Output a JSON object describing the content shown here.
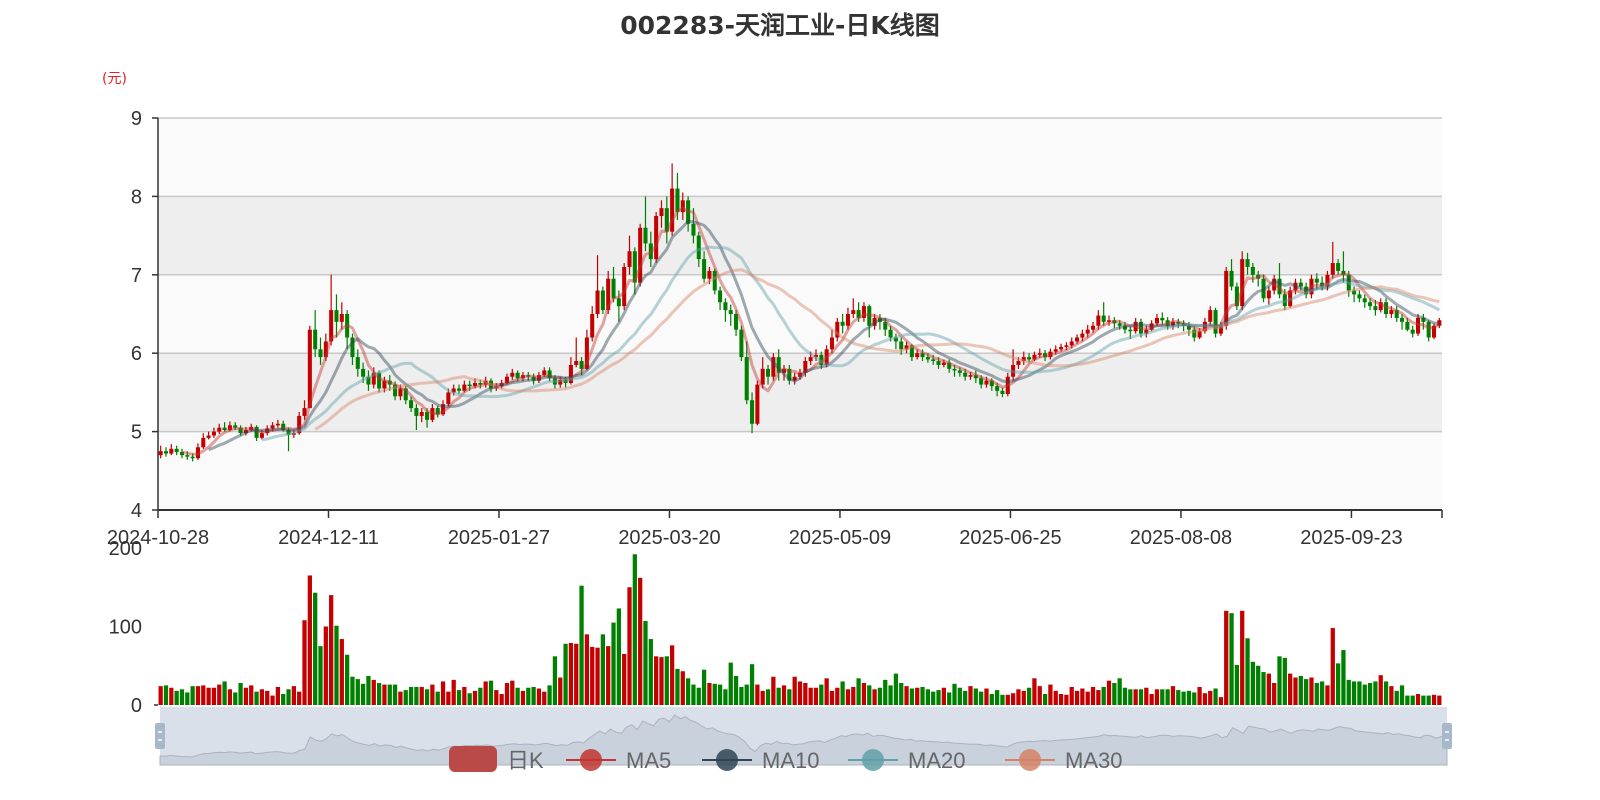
{
  "chart_data": {
    "type": "candlestick",
    "title": "002283-天润工业-日K线图",
    "ylabel": "(元)",
    "price_axis": {
      "ylim": [
        4,
        9
      ],
      "ticks": [
        4,
        5,
        6,
        7,
        8,
        9
      ]
    },
    "volume_axis": {
      "ylim": [
        0,
        200
      ],
      "ticks": [
        0,
        100,
        200
      ]
    },
    "x_tick_labels": [
      "2024-10-28",
      "2024-12-11",
      "2025-01-27",
      "2025-03-20",
      "2025-05-09",
      "2025-06-25",
      "2025-08-08",
      "2025-09-23"
    ],
    "grid": true,
    "legend": {
      "position": "bottom",
      "items": [
        "日K",
        "MA5",
        "MA10",
        "MA20",
        "MA30"
      ]
    },
    "colors": {
      "up": "#c40000",
      "down": "#008000",
      "MA5": "#c23531",
      "MA10": "#2f4554",
      "MA20": "#61a0a8",
      "MA30": "#d48265",
      "legend_k": "#b94a48"
    },
    "open": [
      4.7,
      4.75,
      4.72,
      4.78,
      4.74,
      4.7,
      4.68,
      4.66,
      4.8,
      4.92,
      4.95,
      5.0,
      5.05,
      5.02,
      5.08,
      5.05,
      4.98,
      5.02,
      5.06,
      4.92,
      4.98,
      5.04,
      5.08,
      5.1,
      5.02,
      4.96,
      4.98,
      5.2,
      5.3,
      6.3,
      6.05,
      5.95,
      6.15,
      6.55,
      6.4,
      6.5,
      6.2,
      5.95,
      5.8,
      5.7,
      5.6,
      5.75,
      5.55,
      5.65,
      5.6,
      5.45,
      5.55,
      5.4,
      5.3,
      5.2,
      5.25,
      5.15,
      5.3,
      5.22,
      5.35,
      5.5,
      5.55,
      5.52,
      5.6,
      5.58,
      5.62,
      5.6,
      5.65,
      5.55,
      5.58,
      5.62,
      5.7,
      5.75,
      5.68,
      5.72,
      5.7,
      5.65,
      5.72,
      5.78,
      5.68,
      5.6,
      5.66,
      5.62,
      5.85,
      5.9,
      5.8,
      6.2,
      6.5,
      6.8,
      6.55,
      6.95,
      6.7,
      6.6,
      7.1,
      7.3,
      6.9,
      7.6,
      7.4,
      7.2,
      7.75,
      7.85,
      7.55,
      8.1,
      7.8,
      7.95,
      7.65,
      7.5,
      7.2,
      6.95,
      7.05,
      6.8,
      6.65,
      6.55,
      6.5,
      6.3,
      5.95,
      5.4,
      5.1,
      5.6,
      5.8,
      5.7,
      5.95,
      5.75,
      5.8,
      5.65,
      5.7,
      5.75,
      5.9,
      5.95,
      5.98,
      5.85,
      6.05,
      6.2,
      6.4,
      6.35,
      6.5,
      6.55,
      6.45,
      6.6,
      6.35,
      6.45,
      6.4,
      6.3,
      6.2,
      6.15,
      6.05,
      6.1,
      5.95,
      6.0,
      5.95,
      5.92,
      5.9,
      5.85,
      5.88,
      5.8,
      5.78,
      5.75,
      5.7,
      5.72,
      5.68,
      5.6,
      5.65,
      5.58,
      5.52,
      5.48,
      5.7,
      5.85,
      5.9,
      5.95,
      5.92,
      5.98,
      6.0,
      5.95,
      6.02,
      6.05,
      6.08,
      6.1,
      6.15,
      6.2,
      6.25,
      6.3,
      6.35,
      6.48,
      6.4,
      6.42,
      6.38,
      6.35,
      6.3,
      6.28,
      6.4,
      6.25,
      6.3,
      6.38,
      6.45,
      6.42,
      6.35,
      6.4,
      6.38,
      6.35,
      6.3,
      6.2,
      6.28,
      6.4,
      6.55,
      6.25,
      6.35,
      7.05,
      6.85,
      6.6,
      7.2,
      7.1,
      7.0,
      6.95,
      6.7,
      6.8,
      6.95,
      6.75,
      6.6,
      6.8,
      6.9,
      6.85,
      6.75,
      6.95,
      6.9,
      6.85,
      7.0,
      7.15,
      7.05,
      7.0,
      6.8,
      6.75,
      6.7,
      6.65,
      6.6,
      6.55,
      6.65,
      6.5,
      6.55,
      6.45,
      6.4,
      6.3,
      6.25,
      6.45,
      6.4,
      6.2,
      6.35
    ],
    "close": [
      4.75,
      4.72,
      4.78,
      4.74,
      4.7,
      4.68,
      4.66,
      4.8,
      4.92,
      4.95,
      5.0,
      5.05,
      5.02,
      5.08,
      5.05,
      4.98,
      5.02,
      5.06,
      4.92,
      4.98,
      5.04,
      5.08,
      5.1,
      5.02,
      4.96,
      4.98,
      5.2,
      5.3,
      6.3,
      6.05,
      5.95,
      6.15,
      6.55,
      6.4,
      6.5,
      6.2,
      5.95,
      5.8,
      5.7,
      5.6,
      5.75,
      5.55,
      5.65,
      5.6,
      5.45,
      5.55,
      5.4,
      5.3,
      5.2,
      5.25,
      5.15,
      5.3,
      5.22,
      5.35,
      5.5,
      5.55,
      5.52,
      5.6,
      5.58,
      5.62,
      5.6,
      5.65,
      5.55,
      5.58,
      5.62,
      5.7,
      5.75,
      5.68,
      5.72,
      5.7,
      5.65,
      5.72,
      5.78,
      5.68,
      5.6,
      5.66,
      5.62,
      5.85,
      5.9,
      5.8,
      6.2,
      6.5,
      6.8,
      6.55,
      6.95,
      6.7,
      6.6,
      7.1,
      7.3,
      6.9,
      7.6,
      7.4,
      7.2,
      7.75,
      7.85,
      7.55,
      8.1,
      7.8,
      7.95,
      7.65,
      7.5,
      7.2,
      6.95,
      7.05,
      6.8,
      6.65,
      6.55,
      6.5,
      6.3,
      5.95,
      5.4,
      5.1,
      5.6,
      5.8,
      5.7,
      5.95,
      5.75,
      5.8,
      5.65,
      5.7,
      5.75,
      5.9,
      5.95,
      5.98,
      5.85,
      6.05,
      6.2,
      6.4,
      6.35,
      6.5,
      6.55,
      6.45,
      6.6,
      6.35,
      6.45,
      6.4,
      6.3,
      6.2,
      6.15,
      6.05,
      6.1,
      5.95,
      6.0,
      5.95,
      5.92,
      5.9,
      5.85,
      5.88,
      5.8,
      5.78,
      5.75,
      5.7,
      5.72,
      5.68,
      5.6,
      5.65,
      5.58,
      5.52,
      5.48,
      5.7,
      5.85,
      5.9,
      5.95,
      5.92,
      5.98,
      6.0,
      5.95,
      6.02,
      6.05,
      6.08,
      6.1,
      6.15,
      6.2,
      6.25,
      6.3,
      6.35,
      6.48,
      6.4,
      6.42,
      6.38,
      6.35,
      6.3,
      6.28,
      6.4,
      6.25,
      6.3,
      6.38,
      6.45,
      6.42,
      6.35,
      6.4,
      6.38,
      6.35,
      6.3,
      6.2,
      6.28,
      6.4,
      6.55,
      6.25,
      6.35,
      7.05,
      6.85,
      6.6,
      7.2,
      7.1,
      7.0,
      6.95,
      6.7,
      6.8,
      6.95,
      6.75,
      6.6,
      6.8,
      6.9,
      6.85,
      6.75,
      6.95,
      6.9,
      6.85,
      7.0,
      7.15,
      7.05,
      7.0,
      6.8,
      6.75,
      6.7,
      6.65,
      6.6,
      6.55,
      6.65,
      6.5,
      6.55,
      6.45,
      6.4,
      6.3,
      6.25,
      6.45,
      6.4,
      6.2,
      6.35,
      6.42
    ],
    "high": [
      4.82,
      4.8,
      4.84,
      4.82,
      4.78,
      4.75,
      4.72,
      4.85,
      4.98,
      5.0,
      5.05,
      5.1,
      5.12,
      5.13,
      5.12,
      5.08,
      5.06,
      5.1,
      5.08,
      5.02,
      5.08,
      5.12,
      5.15,
      5.14,
      5.05,
      5.02,
      5.25,
      5.4,
      6.35,
      6.55,
      6.2,
      6.25,
      7.0,
      6.75,
      6.65,
      6.55,
      6.25,
      6.05,
      5.88,
      5.78,
      5.82,
      5.78,
      5.7,
      5.72,
      5.64,
      5.6,
      5.58,
      5.45,
      5.35,
      5.3,
      5.3,
      5.35,
      5.33,
      5.4,
      5.55,
      5.6,
      5.6,
      5.65,
      5.65,
      5.68,
      5.66,
      5.7,
      5.68,
      5.62,
      5.66,
      5.74,
      5.8,
      5.78,
      5.76,
      5.76,
      5.74,
      5.76,
      5.82,
      5.82,
      5.72,
      5.7,
      5.7,
      5.95,
      6.2,
      5.95,
      6.3,
      6.6,
      7.25,
      6.85,
      7.05,
      7.1,
      6.8,
      7.15,
      7.5,
      7.35,
      7.65,
      8.0,
      7.55,
      7.8,
      7.95,
      8.0,
      8.42,
      8.3,
      8.05,
      8.0,
      7.85,
      7.55,
      7.3,
      7.1,
      7.08,
      6.85,
      6.7,
      6.62,
      6.55,
      6.35,
      6.15,
      5.5,
      5.65,
      5.95,
      5.85,
      6.0,
      6.05,
      5.85,
      5.85,
      5.75,
      5.8,
      5.95,
      6.02,
      6.05,
      6.02,
      6.1,
      6.3,
      6.45,
      6.5,
      6.58,
      6.7,
      6.65,
      6.65,
      6.62,
      6.5,
      6.5,
      6.45,
      6.35,
      6.25,
      6.2,
      6.15,
      6.12,
      6.05,
      6.05,
      6.0,
      5.98,
      5.95,
      5.92,
      5.92,
      5.85,
      5.82,
      5.8,
      5.76,
      5.78,
      5.72,
      5.7,
      5.68,
      5.62,
      5.56,
      5.75,
      6.05,
      5.95,
      6.02,
      6.0,
      6.02,
      6.06,
      6.04,
      6.06,
      6.1,
      6.12,
      6.14,
      6.2,
      6.24,
      6.3,
      6.36,
      6.4,
      6.55,
      6.65,
      6.48,
      6.46,
      6.42,
      6.4,
      6.34,
      6.45,
      6.44,
      6.35,
      6.42,
      6.5,
      6.52,
      6.46,
      6.45,
      6.44,
      6.42,
      6.4,
      6.34,
      6.32,
      6.45,
      6.6,
      6.58,
      6.4,
      7.1,
      7.2,
      6.9,
      7.3,
      7.28,
      7.15,
      7.05,
      7.0,
      6.85,
      7.0,
      7.15,
      6.82,
      6.85,
      6.95,
      6.95,
      6.9,
      7.0,
      7.02,
      6.98,
      7.05,
      7.42,
      7.2,
      7.3,
      7.05,
      6.85,
      6.8,
      6.75,
      6.7,
      6.68,
      6.7,
      6.7,
      6.6,
      6.6,
      6.5,
      6.45,
      6.35,
      6.5,
      6.5,
      6.42,
      6.38,
      6.45
    ],
    "low": [
      4.66,
      4.68,
      4.7,
      4.7,
      4.66,
      4.64,
      4.62,
      4.64,
      4.78,
      4.9,
      4.92,
      4.97,
      5.0,
      5.0,
      5.02,
      4.95,
      4.95,
      5.0,
      4.88,
      4.9,
      4.95,
      5.0,
      5.05,
      5.0,
      4.75,
      4.92,
      4.96,
      5.15,
      5.3,
      5.95,
      5.85,
      5.9,
      6.1,
      6.2,
      6.3,
      6.05,
      5.85,
      5.7,
      5.62,
      5.52,
      5.55,
      5.5,
      5.5,
      5.52,
      5.4,
      5.4,
      5.35,
      5.25,
      5.02,
      5.12,
      5.05,
      5.12,
      5.18,
      5.2,
      5.32,
      5.46,
      5.48,
      5.5,
      5.52,
      5.55,
      5.55,
      5.56,
      5.5,
      5.52,
      5.55,
      5.6,
      5.66,
      5.64,
      5.64,
      5.65,
      5.6,
      5.62,
      5.7,
      5.64,
      5.55,
      5.56,
      5.56,
      5.6,
      5.82,
      5.72,
      5.78,
      6.15,
      6.45,
      6.5,
      6.5,
      6.65,
      6.4,
      6.55,
      7.0,
      6.75,
      6.85,
      7.3,
      7.1,
      7.15,
      7.6,
      7.4,
      7.5,
      7.7,
      7.7,
      7.55,
      7.4,
      7.1,
      6.9,
      6.88,
      6.75,
      6.55,
      6.4,
      6.35,
      6.22,
      5.9,
      5.35,
      4.98,
      5.08,
      5.55,
      5.6,
      5.65,
      5.65,
      5.65,
      5.6,
      5.6,
      5.66,
      5.7,
      5.85,
      5.9,
      5.8,
      5.82,
      6.0,
      6.15,
      6.25,
      6.3,
      6.45,
      6.4,
      6.4,
      6.2,
      6.3,
      6.3,
      6.22,
      6.15,
      6.05,
      5.98,
      6.0,
      5.9,
      5.92,
      5.9,
      5.88,
      5.85,
      5.8,
      5.82,
      5.75,
      5.7,
      5.7,
      5.65,
      5.66,
      5.62,
      5.55,
      5.56,
      5.52,
      5.45,
      5.44,
      5.45,
      5.65,
      5.8,
      5.85,
      5.88,
      5.9,
      5.94,
      5.9,
      5.92,
      5.98,
      6.02,
      6.04,
      6.06,
      6.12,
      6.15,
      6.2,
      6.26,
      6.3,
      6.35,
      6.35,
      6.32,
      6.3,
      6.25,
      6.18,
      6.25,
      6.2,
      6.2,
      6.28,
      6.35,
      6.36,
      6.3,
      6.3,
      6.32,
      6.28,
      6.22,
      6.15,
      6.18,
      6.25,
      6.35,
      6.2,
      6.22,
      6.3,
      6.8,
      6.55,
      6.55,
      7.0,
      6.9,
      6.85,
      6.65,
      6.62,
      6.75,
      6.7,
      6.55,
      6.58,
      6.75,
      6.8,
      6.7,
      6.7,
      6.82,
      6.8,
      6.8,
      6.95,
      7.0,
      6.9,
      6.72,
      6.65,
      6.65,
      6.58,
      6.55,
      6.48,
      6.52,
      6.45,
      6.45,
      6.4,
      6.3,
      6.28,
      6.2,
      6.22,
      6.3,
      6.15,
      6.18,
      6.32
    ],
    "volume": [
      24,
      25,
      22,
      18,
      20,
      16,
      24,
      24,
      25,
      22,
      22,
      26,
      30,
      20,
      16,
      28,
      22,
      25,
      17,
      20,
      18,
      12,
      23,
      14,
      20,
      24,
      17,
      108,
      165,
      143,
      75,
      100,
      140,
      101,
      84,
      64,
      36,
      33,
      27,
      37,
      32,
      28,
      26,
      26,
      26,
      17,
      19,
      23,
      23,
      23,
      20,
      26,
      17,
      30,
      17,
      32,
      19,
      23,
      15,
      18,
      22,
      30,
      31,
      19,
      14,
      28,
      31,
      22,
      18,
      22,
      23,
      21,
      17,
      25,
      62,
      35,
      78,
      79,
      78,
      152,
      90,
      74,
      73,
      90,
      75,
      105,
      123,
      65,
      150,
      192,
      162,
      107,
      84,
      62,
      61,
      62,
      76,
      46,
      43,
      34,
      26,
      22,
      45,
      28,
      27,
      26,
      20,
      54,
      37,
      23,
      26,
      52,
      26,
      18,
      20,
      36,
      22,
      25,
      20,
      36,
      30,
      28,
      22,
      22,
      26,
      34,
      18,
      22,
      30,
      20,
      23,
      34,
      28,
      25,
      20,
      22,
      32,
      25,
      40,
      28,
      24,
      21,
      22,
      23,
      20,
      17,
      19,
      22,
      16,
      27,
      22,
      18,
      24,
      21,
      17,
      21,
      14,
      19,
      13,
      13,
      15,
      20,
      18,
      22,
      34,
      24,
      14,
      26,
      18,
      14,
      13,
      23,
      18,
      21,
      17,
      23,
      19,
      23,
      31,
      28,
      34,
      22,
      20,
      20,
      20,
      22,
      14,
      20,
      20,
      20,
      24,
      19,
      17,
      18,
      16,
      23,
      15,
      18,
      21,
      10,
      120,
      117,
      51,
      120,
      85,
      55,
      50,
      42,
      40,
      28,
      62,
      60,
      40,
      35,
      37,
      33,
      35,
      28,
      30,
      25,
      98,
      53,
      70,
      32,
      30,
      30,
      26,
      28,
      30,
      38,
      30,
      24,
      18,
      25,
      12,
      12,
      14,
      12,
      12,
      13,
      12
    ]
  }
}
